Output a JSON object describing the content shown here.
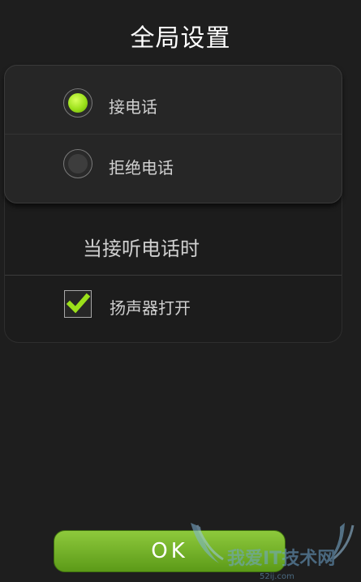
{
  "dialog": {
    "title": "全局设置"
  },
  "radio_group": {
    "options": [
      {
        "label": "接电话",
        "selected": true
      },
      {
        "label": "拒绝电话",
        "selected": false
      }
    ]
  },
  "section": {
    "heading": "当接听电话时"
  },
  "options": {
    "speaker_label": "扬声器打开",
    "speaker_checked": true
  },
  "ok_button": {
    "label": "OK"
  },
  "watermark": {
    "text": "我爱IT技术网",
    "sub": "52ij.com"
  },
  "colors": {
    "accent": "#9be01a",
    "background": "#1e1e1e",
    "button": "#6fae22"
  }
}
